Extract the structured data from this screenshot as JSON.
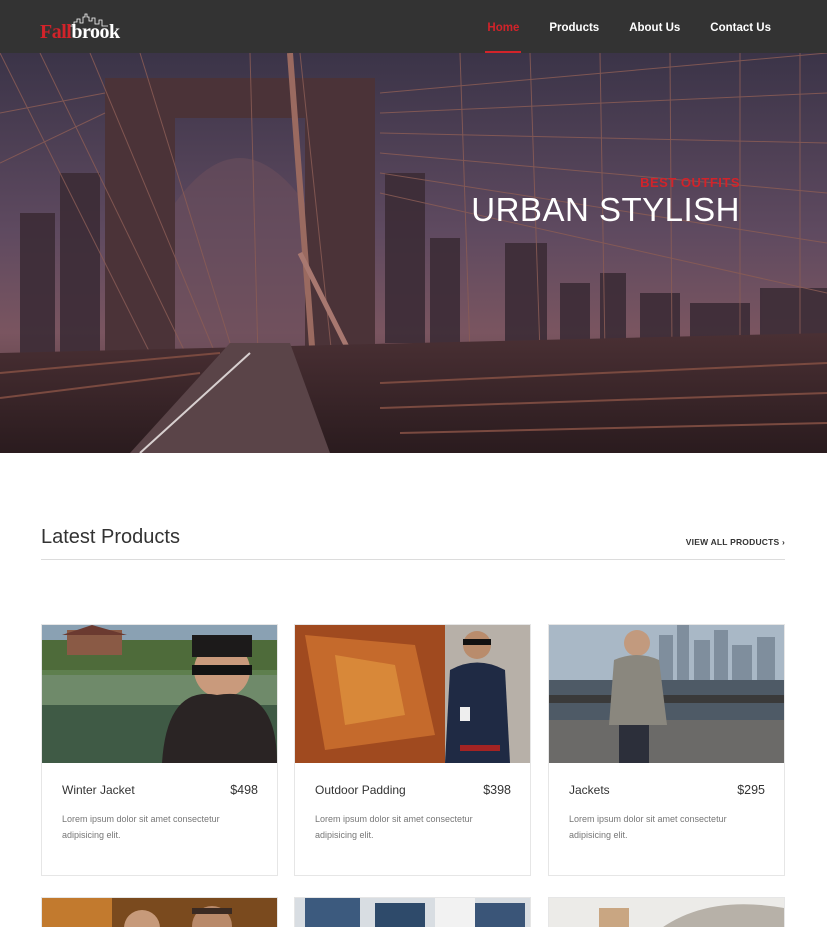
{
  "header": {
    "logo": {
      "part1": "Fall",
      "part2": "brook"
    },
    "nav": [
      {
        "label": "Home",
        "active": true
      },
      {
        "label": "Products",
        "active": false
      },
      {
        "label": "About Us",
        "active": false
      },
      {
        "label": "Contact Us",
        "active": false
      }
    ]
  },
  "hero": {
    "subtitle": "Best Outfits",
    "title": "URBAN STYLISH"
  },
  "products_section": {
    "title": "Latest Products",
    "view_all": "View All Products ›"
  },
  "products": [
    {
      "name": "Winter Jacket",
      "price": "$498",
      "description": "Lorem ipsum dolor sit amet consectetur adipisicing elit."
    },
    {
      "name": "Outdoor Padding",
      "price": "$398",
      "description": "Lorem ipsum dolor sit amet consectetur adipisicing elit."
    },
    {
      "name": "Jackets",
      "price": "$295",
      "description": "Lorem ipsum dolor sit amet consectetur adipisicing elit."
    }
  ],
  "colors": {
    "accent": "#d2232a",
    "header_bg": "#333333"
  }
}
